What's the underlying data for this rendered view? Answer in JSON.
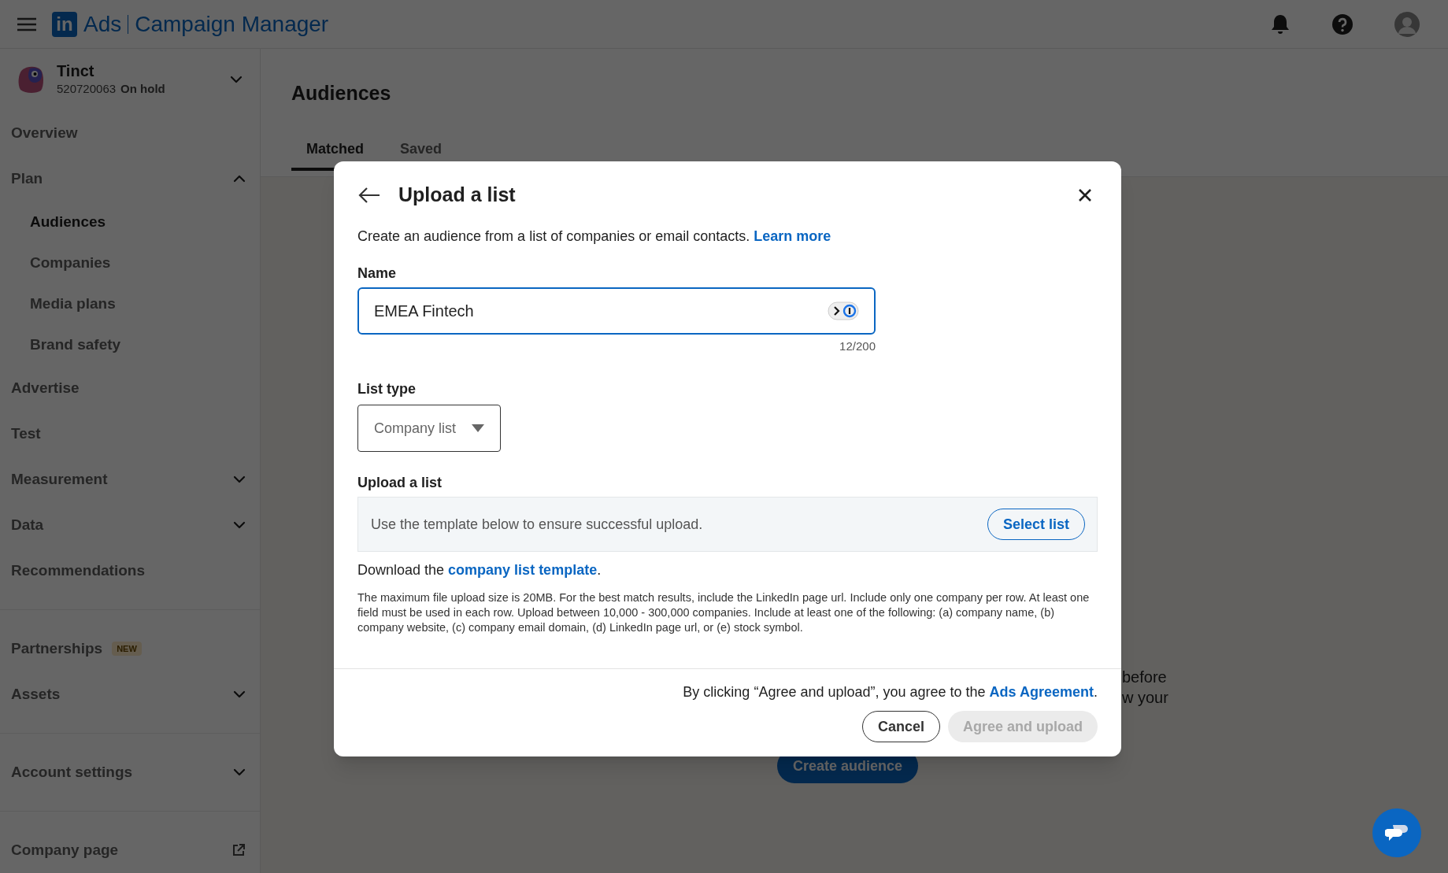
{
  "header": {
    "logo_mark": "in",
    "product": "Ads",
    "title": "Campaign Manager"
  },
  "account": {
    "name": "Tinct",
    "id": "520720063",
    "status": "On hold",
    "expanded": false
  },
  "sidebar": {
    "sections": [
      [
        {
          "label": "Overview",
          "selected": false
        },
        {
          "label": "Plan",
          "selected": false,
          "expanded": true,
          "children": [
            {
              "label": "Audiences",
              "selected": true
            },
            {
              "label": "Companies",
              "selected": false
            },
            {
              "label": "Media plans",
              "selected": false
            },
            {
              "label": "Brand safety",
              "selected": false
            }
          ]
        },
        {
          "label": "Advertise",
          "selected": false
        },
        {
          "label": "Test",
          "selected": false
        },
        {
          "label": "Measurement",
          "selected": false,
          "expanded": false
        },
        {
          "label": "Data",
          "selected": false,
          "expanded": false
        },
        {
          "label": "Recommendations",
          "selected": false
        }
      ],
      [
        {
          "label": "Partnerships",
          "selected": false,
          "badge": "NEW"
        },
        {
          "label": "Assets",
          "selected": false,
          "expanded": false
        }
      ],
      [
        {
          "label": "Account settings",
          "selected": false,
          "expanded": false
        }
      ],
      [
        {
          "label": "Company page",
          "selected": false,
          "external": true
        }
      ]
    ]
  },
  "page": {
    "title": "Audiences",
    "tabs": [
      {
        "label": "Matched",
        "selected": true
      },
      {
        "label": "Saved",
        "selected": false
      }
    ],
    "background_lines": [
      "before",
      "w your"
    ],
    "create_button": "Create audience"
  },
  "dialog": {
    "title": "Upload a list",
    "description": "Create an audience from a list of companies or email contacts.",
    "learn_more": "Learn more",
    "name_label": "Name",
    "name_value": "EMEA Fintech",
    "name_counter": "12/200",
    "list_type_label": "List type",
    "list_type_value": "Company list",
    "upload_label": "Upload a list",
    "upload_hint": "Use the template below to ensure successful upload.",
    "select_button": "Select list",
    "download_prefix": "Download the",
    "download_link": "company list template",
    "download_suffix": ".",
    "fine_print": "The maximum file upload size is 20MB. For the best match results, include the LinkedIn page url. Include only one company per row. At least one field must be used in each row. Upload between 10,000 - 300,000 companies. Include at least one of the following: (a) company name, (b) company website, (c) company email domain, (d) LinkedIn page url, or (e) stock symbol.",
    "agreement_prefix": "By clicking “Agree and upload”, you agree to the",
    "agreement_link": "Ads Agreement",
    "agreement_suffix": ".",
    "buttons": [
      {
        "label": "Cancel",
        "kind": "secondary",
        "disabled": false
      },
      {
        "label": "Agree and upload",
        "kind": "primary",
        "disabled": true
      }
    ]
  }
}
